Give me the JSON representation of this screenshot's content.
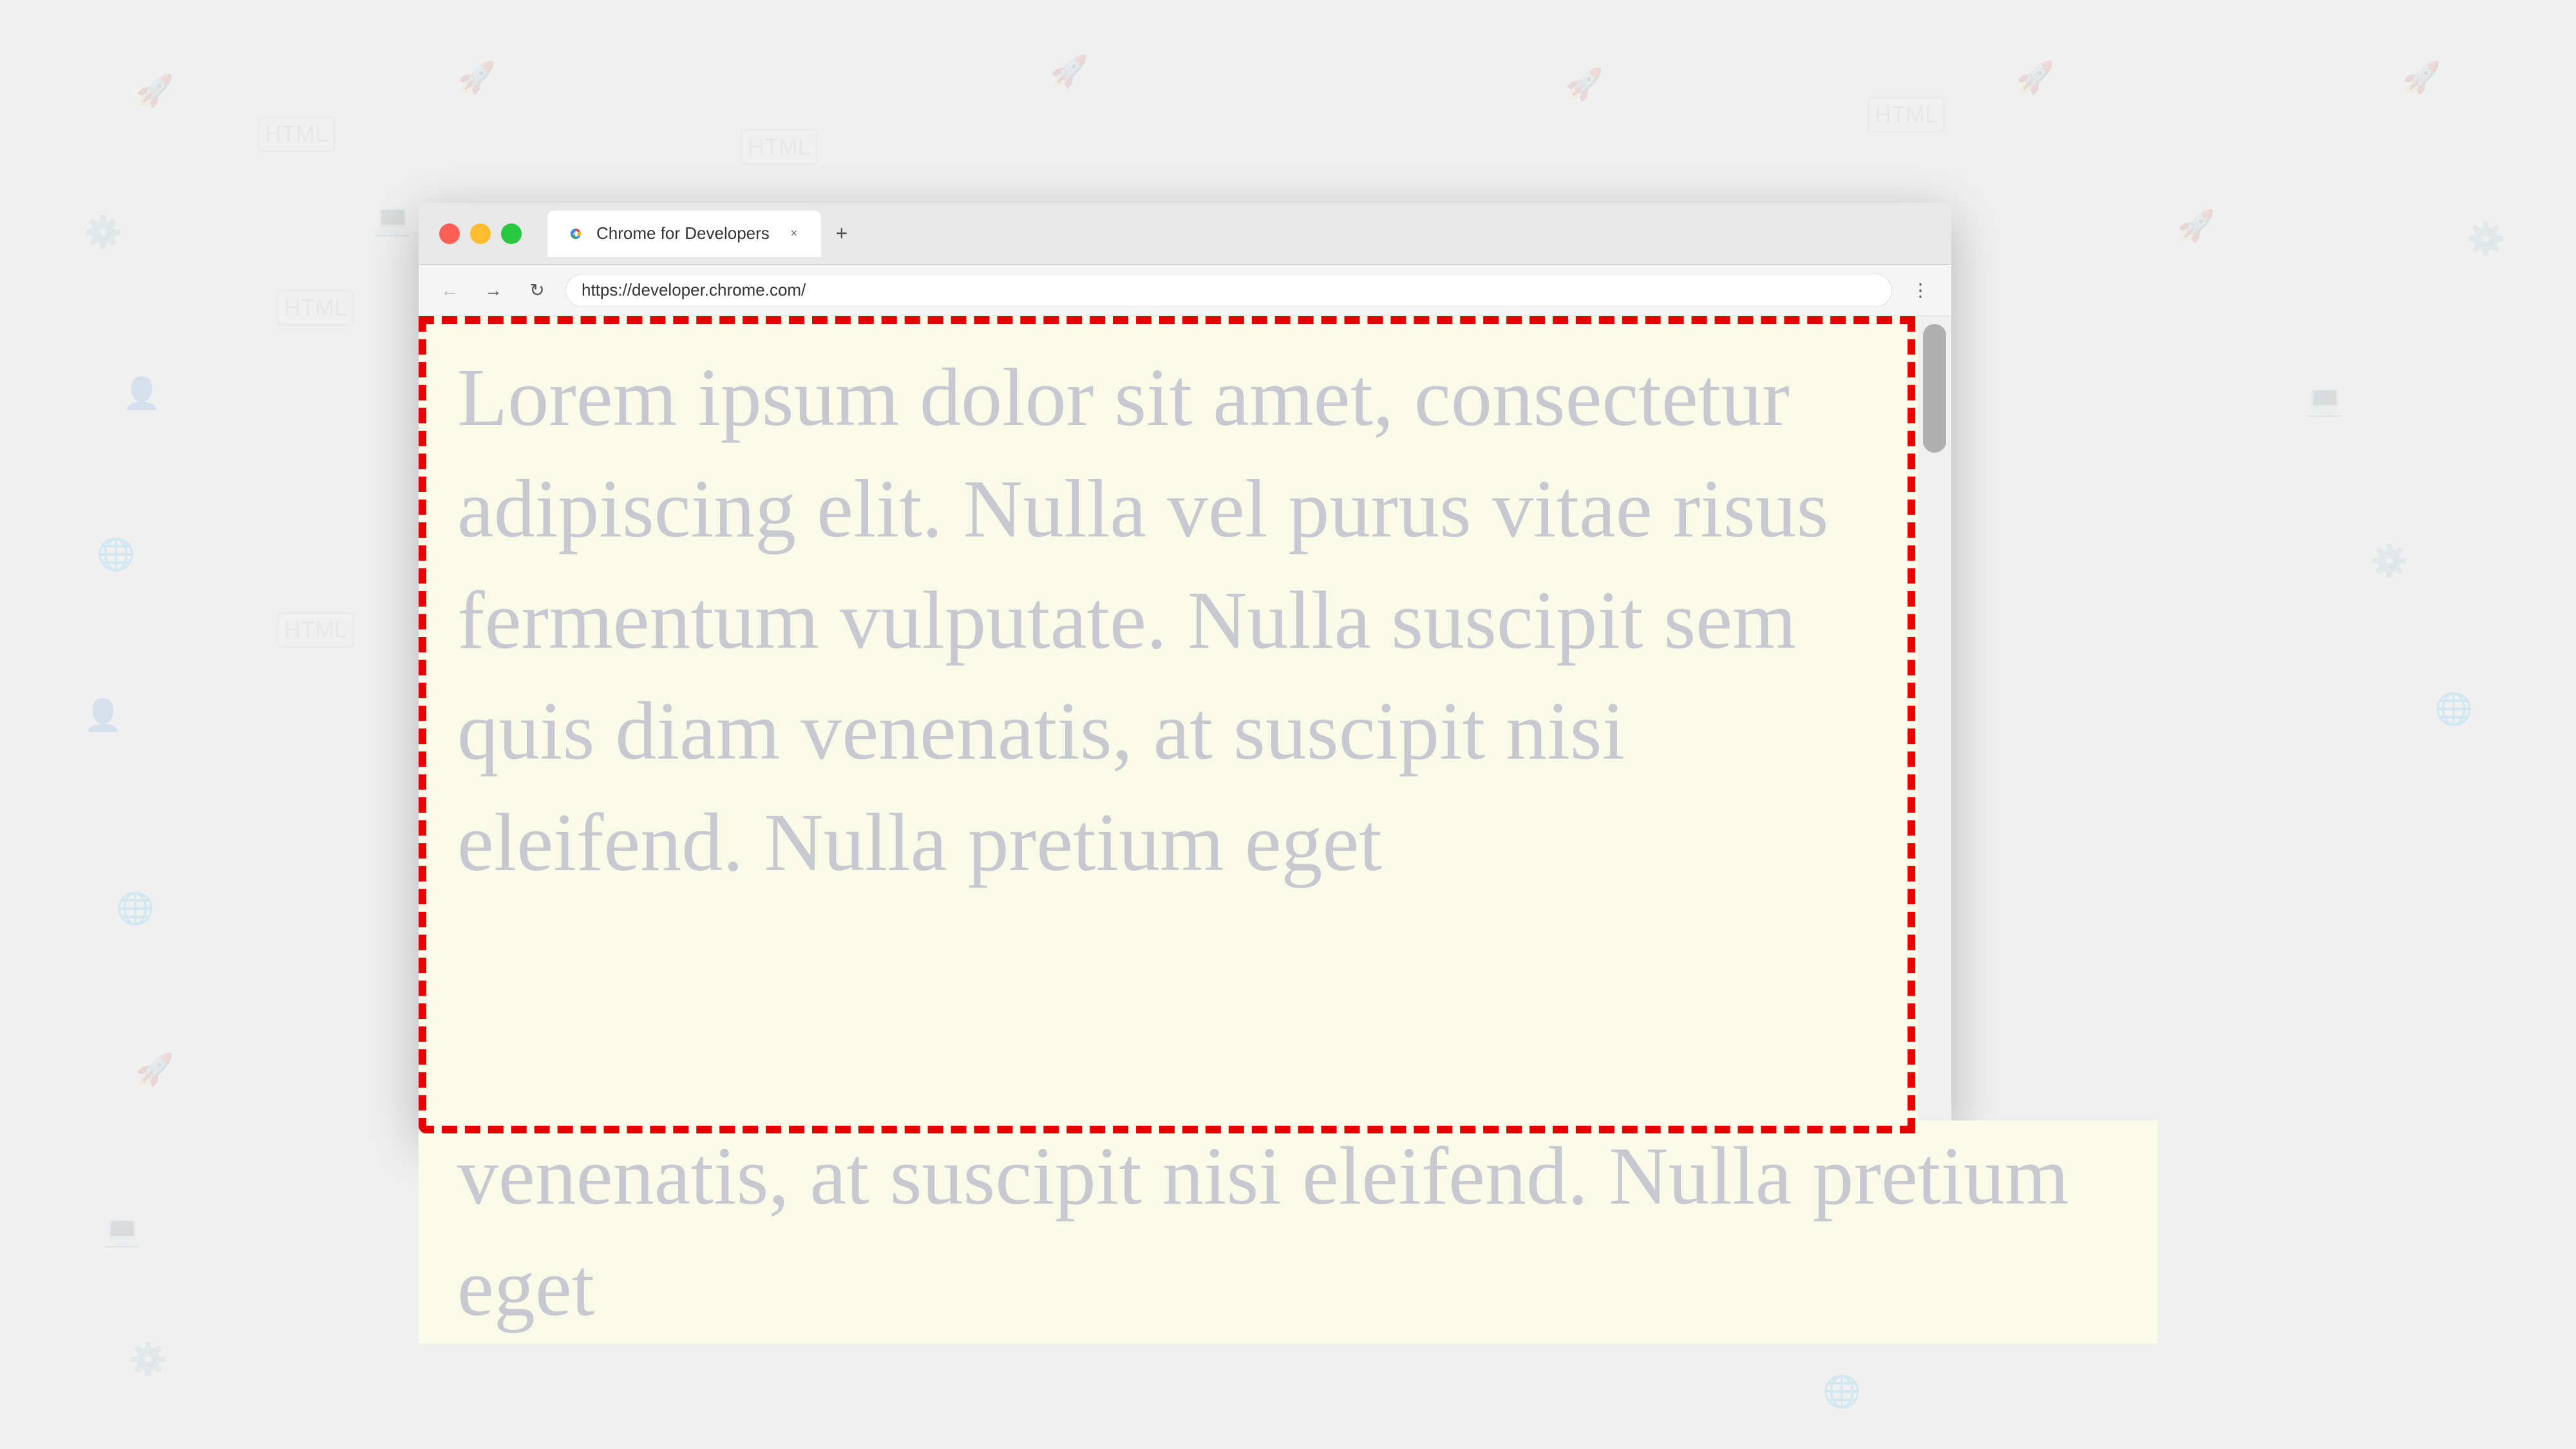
{
  "background": {
    "color": "#f0f0f0"
  },
  "browser": {
    "title": "Chrome for Developers",
    "url": "https://developer.chrome.com/",
    "tab": {
      "label": "Chrome for Developers",
      "close_label": "×"
    },
    "controls": {
      "close_label": "",
      "minimize_label": "",
      "maximize_label": ""
    },
    "new_tab_label": "+",
    "nav": {
      "back_label": "←",
      "forward_label": "→",
      "refresh_label": "↻",
      "menu_label": "⋮"
    }
  },
  "page": {
    "content": "Lorem ipsum dolor sit amet, consectetur adipiscing elit. Nulla vel purus vitae risus fermentum vulputate. Nulla suscipit sem quis diam venenatis, at suscipit nisi eleifend. Nulla pretium eget",
    "overflow_content": "venenatis, at suscipit nisi eleifend. Nulla pretium eget"
  }
}
